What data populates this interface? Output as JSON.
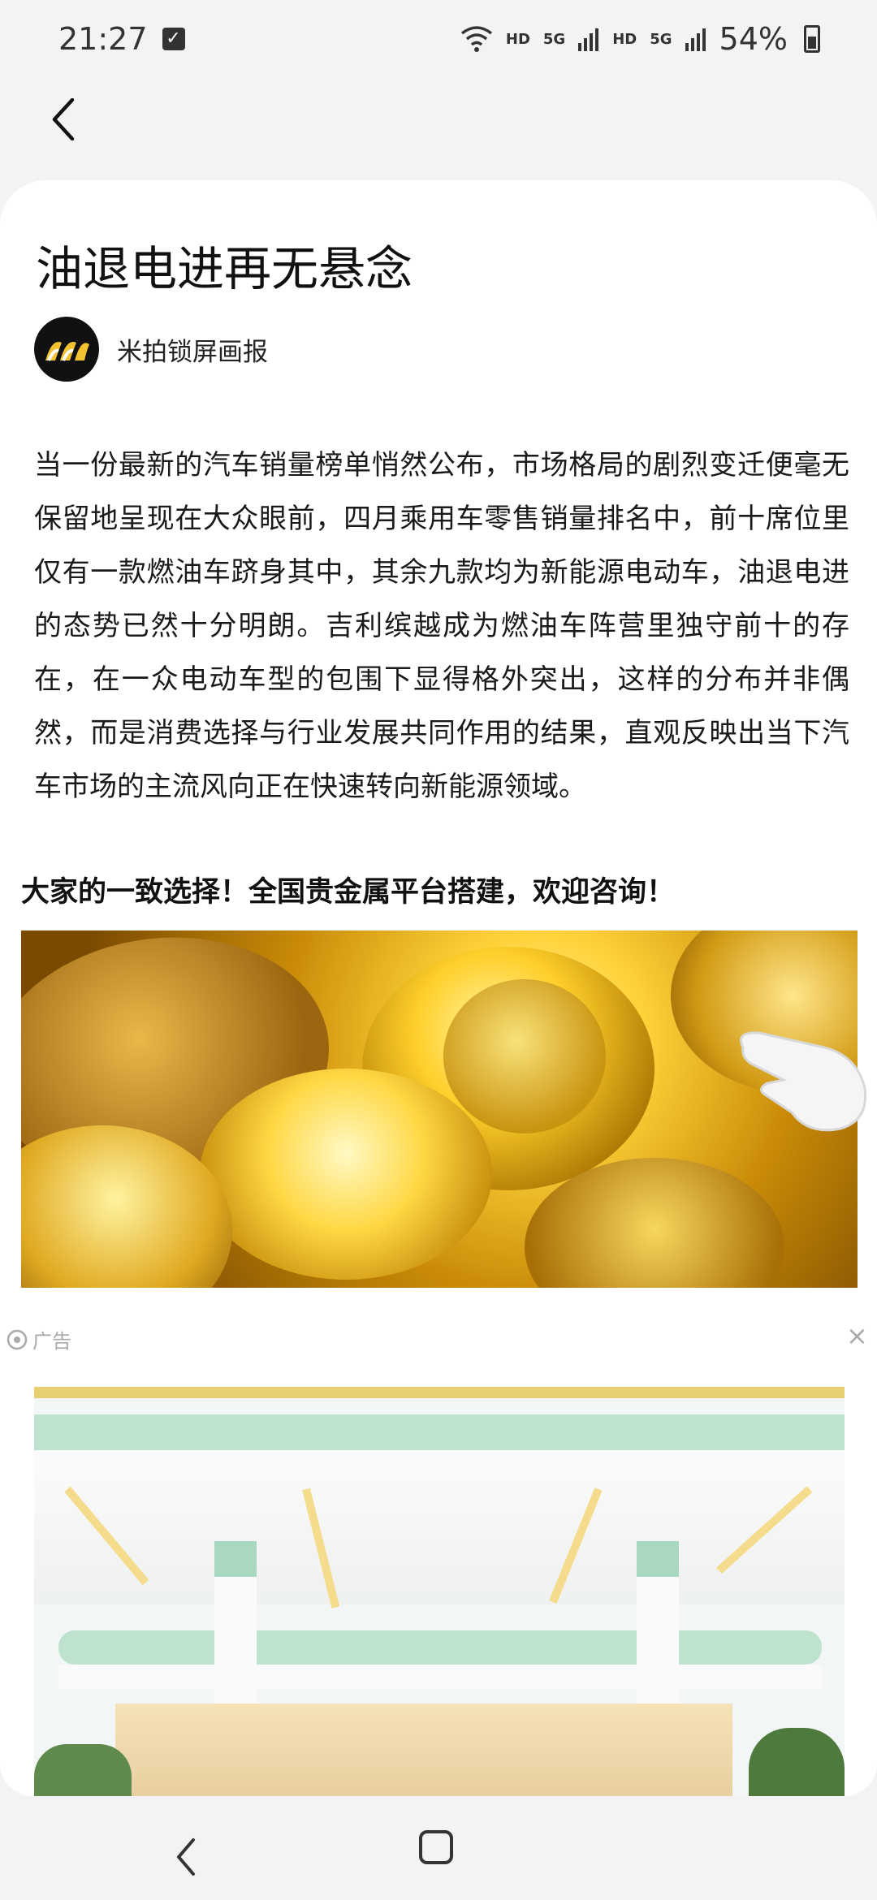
{
  "status_bar": {
    "time": "21:27",
    "battery": "54%",
    "network_1": "HD",
    "network_2": "HD",
    "signal_1": "5G",
    "signal_2": "5G"
  },
  "article": {
    "title": "油退电进再无悬念",
    "author": "米拍锁屏画报",
    "body": "当一份最新的汽车销量榜单悄然公布，市场格局的剧烈变迁便毫无保留地呈现在大众眼前，四月乘用车零售销量排名中，前十席位里仅有一款燃油车跻身其中，其余九款均为新能源电动车，油退电进的态势已然十分明朗。吉利缤越成为燃油车阵营里独守前十的存在，在一众电动车型的包围下显得格外突出，这样的分布并非偶然，而是消费选择与行业发展共同作用的结果，直观反映出当下汽车市场的主流风向正在快速转向新能源领域。"
  },
  "ad": {
    "title": "大家的一致选择！全国贵金属平台搭建，欢迎咨询！",
    "label": "广告",
    "close": "×"
  }
}
